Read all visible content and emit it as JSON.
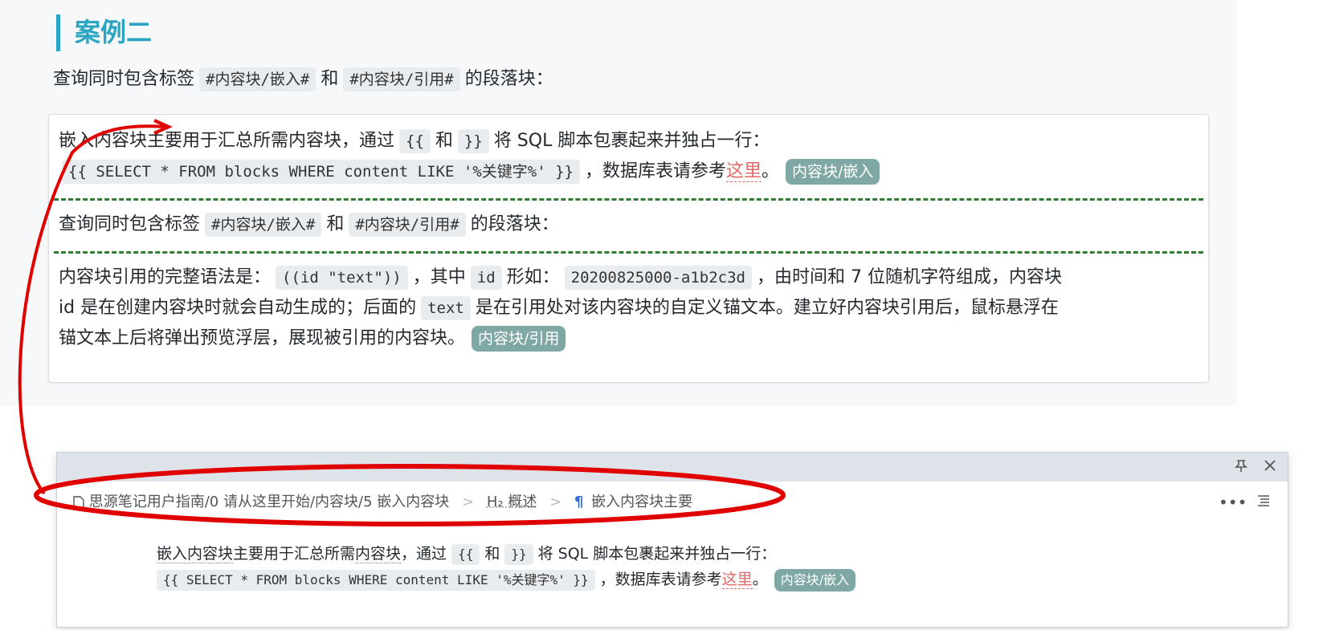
{
  "heading": "案例二",
  "intro": {
    "prefix": "查询同时包含标签",
    "tag1": "#内容块/嵌入#",
    "and": "和",
    "tag2": "#内容块/引用#",
    "suffix": "的段落块："
  },
  "card": {
    "block1": {
      "line1_a": "嵌入内容块主要用于汇总所需内容块，通过",
      "open": "{{",
      "and": "和",
      "close": "}}",
      "line1_b": "将 SQL 脚本包裹起来并独占一行：",
      "sql": "{{ SELECT * FROM blocks WHERE content LIKE '%关键字%' }}",
      "line2_b": "，数据库表请参考",
      "link": "这里",
      "end": "。",
      "tag": "内容块/嵌入"
    },
    "block2": {
      "prefix": "查询同时包含标签",
      "tag1": "#内容块/嵌入#",
      "and": "和",
      "tag2": "#内容块/引用#",
      "suffix": "的段落块："
    },
    "block3": {
      "l1_a": "内容块引用的完整语法是：",
      "code1": "((id \"text\"))",
      "l1_b": "，其中",
      "code2": "id",
      "l1_c": "形如：",
      "code3": "20200825000-a1b2c3d",
      "l1_d": "，由时间和 7 位随机字符组成，内容块",
      "l2_a": "id 是在创建内容块时就会自动生成的；后面的",
      "code4": "text",
      "l2_b": "是在引用处对该内容块的自定义锚文本。建立好内容块引用后，鼠标悬浮在",
      "l3_a": "锚文本上后将弹出预览浮层，展现被引用的内容块。",
      "tag": "内容块/引用"
    }
  },
  "popup": {
    "pin_icon": "pin-icon",
    "close_icon": "close-icon",
    "breadcrumb": {
      "path": "思源笔记用户指南/0 请从这里开始/内容块/5 嵌入内容块",
      "heading": "H₂ 概述",
      "block": "嵌入内容块主要"
    },
    "more": "•••",
    "body": {
      "a": "嵌入内容块",
      "b": "主要用于汇总所需",
      "c": "内容块",
      "d": "，通过",
      "open": "{{",
      "and": "和",
      "close": "}}",
      "e": "将 SQL 脚本包裹起来并独占一行：",
      "sql": "{{ SELECT * FROM blocks WHERE content LIKE '%关键字%' }}",
      "f": "，数据库表请参考",
      "link": "这里",
      "end": "。",
      "tag": "内容块/嵌入"
    }
  },
  "colors": {
    "heading": "#2ba6c2",
    "tag_bg": "#7fa8a5",
    "separator": "#2f7d32",
    "annotation": "#e00000",
    "link": "#e26a6a"
  }
}
